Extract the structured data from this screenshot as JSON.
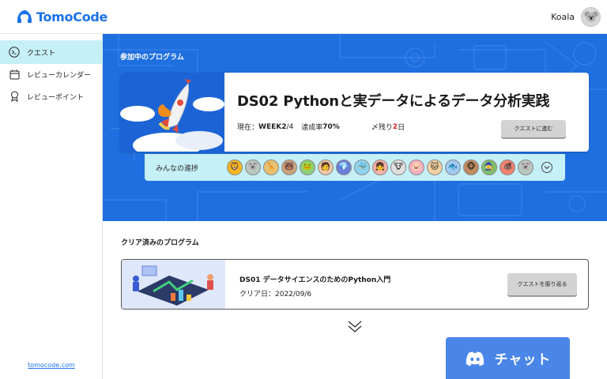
{
  "header": {
    "logo_text": "TomoCode",
    "user_name": "Koala"
  },
  "sidebar": {
    "items": [
      {
        "label": "クエスト",
        "icon": "terminal-icon",
        "active": true
      },
      {
        "label": "レビューカレンダー",
        "icon": "calendar-icon",
        "active": false
      },
      {
        "label": "レビューポイント",
        "icon": "award-ribbon-icon",
        "active": false
      }
    ],
    "footer_link": "tomocode.com"
  },
  "current": {
    "section_title": "参加中のプログラム",
    "program_name": "DS02 Pythonと実データによるデータ分析実践",
    "status_prefix": "現在：",
    "week": "WEEK2",
    "week_total": "/4",
    "progress_prefix": "達成率",
    "progress_value": "70%",
    "deadline_prefix": "〆残り",
    "deadline_days": "2",
    "deadline_suffix": "日",
    "button_label": "クエストに進む",
    "everyone_label": "みんなの進捗"
  },
  "avatars": [
    {
      "name": "lion-avatar",
      "glyph": "🦁",
      "bg": "#f5b820"
    },
    {
      "name": "koala-avatar",
      "glyph": "🐨",
      "bg": "#b9c7c0"
    },
    {
      "name": "giraffe-avatar",
      "glyph": "🦒",
      "bg": "#e8c070"
    },
    {
      "name": "bear-avatar",
      "glyph": "🐻",
      "bg": "#c9a27c"
    },
    {
      "name": "frog-avatar",
      "glyph": "🐸",
      "bg": "#8ccf7a"
    },
    {
      "name": "person-avatar",
      "glyph": "🧑",
      "bg": "#f0c6a4"
    },
    {
      "name": "gem-avatar",
      "glyph": "💎",
      "bg": "#6a7fd8"
    },
    {
      "name": "whale-avatar",
      "glyph": "🐳",
      "bg": "#8fd3ee"
    },
    {
      "name": "girl-avatar",
      "glyph": "👧",
      "bg": "#f7b0a8"
    },
    {
      "name": "cow-avatar",
      "glyph": "🐮",
      "bg": "#e0e0e0"
    },
    {
      "name": "pig-avatar",
      "glyph": "🐷",
      "bg": "#f5b0c0"
    },
    {
      "name": "cat-avatar",
      "glyph": "🐱",
      "bg": "#f0d0a0"
    },
    {
      "name": "fish-avatar",
      "glyph": "🐟",
      "bg": "#9ec9f0"
    },
    {
      "name": "monkey-avatar",
      "glyph": "🐵",
      "bg": "#c08a60"
    },
    {
      "name": "witch-avatar",
      "glyph": "🧙",
      "bg": "#7fbf6a"
    },
    {
      "name": "boar-avatar",
      "glyph": "🐗",
      "bg": "#f08070"
    },
    {
      "name": "koala2-avatar",
      "glyph": "🐨",
      "bg": "#b9c7c0"
    }
  ],
  "cleared": {
    "section_title": "クリア済みのプログラム",
    "program_name": "DS01 データサイエンスのためのPython入門",
    "date_label": "クリア日：2022/09/6",
    "button_label": "クエストを振り返る"
  },
  "chat": {
    "label": "チャット"
  },
  "colors": {
    "brand": "#1a73e8",
    "hero_bg": "#1f6fe0",
    "active_nav": "#c6f0f7",
    "chat": "#4a86e8",
    "deadline": "#e02020"
  }
}
